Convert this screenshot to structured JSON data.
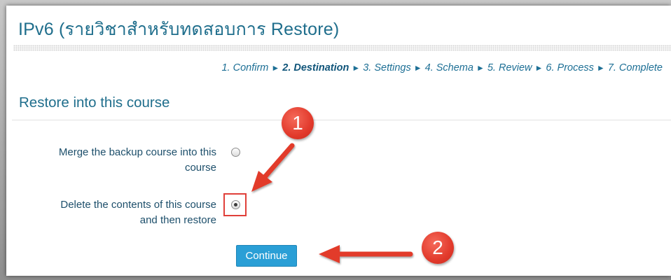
{
  "page": {
    "title": "IPv6 (รายวิชาสำหรับทดสอบการ Restore)"
  },
  "progress": {
    "steps": [
      {
        "label": "1. Confirm",
        "current": false
      },
      {
        "label": "2. Destination",
        "current": true
      },
      {
        "label": "3. Settings",
        "current": false
      },
      {
        "label": "4. Schema",
        "current": false
      },
      {
        "label": "5. Review",
        "current": false
      },
      {
        "label": "6. Process",
        "current": false
      },
      {
        "label": "7. Complete",
        "current": false
      }
    ],
    "separator": "►"
  },
  "section": {
    "heading": "Restore into this course"
  },
  "options": [
    {
      "label_line1": "Merge the backup course into this",
      "label_line2": "course",
      "checked": false
    },
    {
      "label_line1": "Delete the contents of this course",
      "label_line2": "and then restore",
      "checked": true
    }
  ],
  "actions": {
    "continue_label": "Continue"
  },
  "callouts": {
    "first": "1",
    "second": "2"
  },
  "colors": {
    "heading": "#1f6e8c",
    "button": "#2a9fd6",
    "callout": "#e23a2c"
  }
}
